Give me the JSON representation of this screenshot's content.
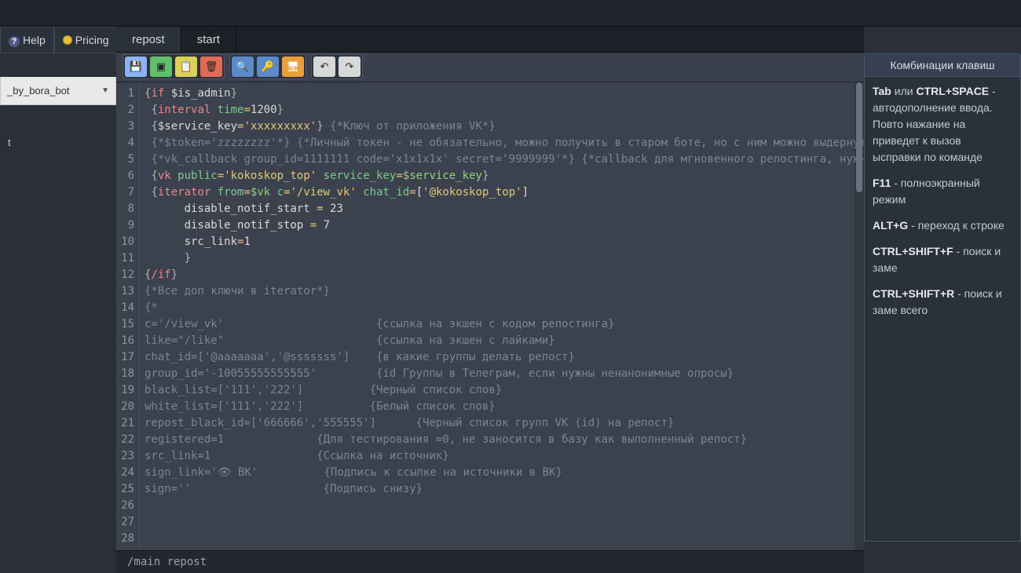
{
  "nav": {
    "help": "Help",
    "pricing": "Pricing"
  },
  "sidebar": {
    "dropdown": "_by_bora_bot",
    "item1": "t"
  },
  "tabs": [
    {
      "label": "repost",
      "active": true
    },
    {
      "label": "start",
      "active": false
    }
  ],
  "toolbar": {
    "save": "save",
    "run": "run",
    "copy": "copy",
    "del": "delete",
    "find": "find",
    "key": "key",
    "screen": "fullscreen",
    "undo": "undo",
    "redo": "redo"
  },
  "editor": {
    "line_count": 28,
    "lines": [
      [
        [
          "br",
          "{"
        ],
        [
          "kw",
          "if"
        ],
        [
          "var",
          " $is_admin"
        ],
        [
          "br",
          "}"
        ]
      ],
      [
        [
          "var",
          " "
        ],
        [
          "br",
          "{"
        ],
        [
          "kw",
          "interval"
        ],
        [
          "var",
          " "
        ],
        [
          "attr",
          "time"
        ],
        [
          "eq",
          "="
        ],
        [
          "num",
          "1200"
        ],
        [
          "br",
          "}"
        ]
      ],
      [
        [
          "var",
          " "
        ],
        [
          "br",
          "{"
        ],
        [
          "var",
          "$service_key"
        ],
        [
          "eq",
          "="
        ],
        [
          "str",
          "'xxxxxxxxx'"
        ],
        [
          "br",
          "}"
        ],
        [
          "var",
          " "
        ],
        [
          "cmt",
          "{*Ключ от приложения VK*}"
        ]
      ],
      [
        [
          "var",
          " "
        ],
        [
          "cmt",
          "{*$token='zzzzzzzz'*} {*Личный токен - не обязательно, можно получить в старом боте, но с ним можно выдернуть исход"
        ]
      ],
      [
        [
          "var",
          " "
        ],
        [
          "cmt",
          "{*vk_callback group_id=1111111 code='x1x1x1x' secret='9999999'*} {*callback для мгновенного репостинга, нужно настр"
        ]
      ],
      [
        [
          "var",
          " "
        ],
        [
          "br",
          "{"
        ],
        [
          "kw",
          "vk"
        ],
        [
          "var",
          " "
        ],
        [
          "attr",
          "public"
        ],
        [
          "eq",
          "="
        ],
        [
          "str",
          "'kokoskop_top'"
        ],
        [
          "var",
          " "
        ],
        [
          "attr",
          "service_key"
        ],
        [
          "eq",
          "="
        ],
        [
          "varb",
          "$service_key"
        ],
        [
          "br",
          "}"
        ]
      ],
      [
        [
          "var",
          " "
        ],
        [
          "br",
          "{"
        ],
        [
          "kw",
          "iterator"
        ],
        [
          "var",
          " "
        ],
        [
          "attr",
          "from"
        ],
        [
          "eq",
          "="
        ],
        [
          "varb",
          "$vk"
        ],
        [
          "var",
          " "
        ],
        [
          "attr",
          "c"
        ],
        [
          "eq",
          "="
        ],
        [
          "str",
          "'/view_vk'"
        ],
        [
          "var",
          " "
        ],
        [
          "attr",
          "chat_id"
        ],
        [
          "eq",
          "="
        ],
        [
          "var",
          "["
        ],
        [
          "str",
          "'@kokoskop_top'"
        ],
        [
          "var",
          "]"
        ]
      ],
      [
        [
          "var",
          "      disable_notif_start "
        ],
        [
          "eq",
          "= "
        ],
        [
          "num",
          "23"
        ]
      ],
      [
        [
          "var",
          "      disable_notif_stop "
        ],
        [
          "eq",
          "= "
        ],
        [
          "num",
          "7"
        ]
      ],
      [
        [
          "var",
          "      src_link"
        ],
        [
          "eq",
          "="
        ],
        [
          "num",
          "1"
        ]
      ],
      [
        [
          "var",
          "      "
        ],
        [
          "br",
          "}"
        ]
      ],
      [
        [
          "br",
          "{"
        ],
        [
          "kw",
          "/if"
        ],
        [
          "br",
          "}"
        ]
      ],
      [
        [
          "var",
          ""
        ]
      ],
      [
        [
          "var",
          ""
        ]
      ],
      [
        [
          "var",
          ""
        ]
      ],
      [
        [
          "cmt",
          "{*Все доп ключи в iterator*}"
        ]
      ],
      [
        [
          "cmt",
          "{*"
        ]
      ],
      [
        [
          "cmt",
          "c='/view_vk'                       {ссылка на экшен с кодом репостинга}"
        ]
      ],
      [
        [
          "cmt",
          "like=\"/like\"                       {ссылка на экшен с лайками}"
        ]
      ],
      [
        [
          "cmt",
          "chat_id=['@aaaaaaa','@sssssss']    {в какие группы делать репост}"
        ]
      ],
      [
        [
          "cmt",
          "group_id='-10055555555555'         {id Группы в Телеграм, если нужны ненанонимные опросы}"
        ]
      ],
      [
        [
          "cmt",
          "black_list=['111','222']          {Черный список слов}"
        ]
      ],
      [
        [
          "cmt",
          "white_list=['111','222']          {Белый список слов}"
        ]
      ],
      [
        [
          "cmt",
          "repost_black_id=['666666','555555']      {Черный список групп VK (id) на репост}"
        ]
      ],
      [
        [
          "cmt",
          "registered=1              {Для тестирования =0, не заносится в базу как выполненный репост}"
        ]
      ],
      [
        [
          "cmt",
          "src_link=1                {Ссылка на источник}"
        ]
      ],
      [
        [
          "cmt",
          "sign_link='👁 ВК'          {Подпись к ссылке на источники в ВК}"
        ]
      ],
      [
        [
          "cmt",
          "sign=''                    {Подпись снизу}"
        ]
      ]
    ]
  },
  "right_panel": {
    "title": "Комбинации клавиш",
    "tips": [
      {
        "bold": "Tab",
        "mid": " или ",
        "bold2": "CTRL+SPACE",
        "rest": " - автодополнение ввода. Повто нажание на приведет к вызов ысправки по команде"
      },
      {
        "bold": "F11",
        "rest": " - полноэкранный режим"
      },
      {
        "bold": "ALT+G",
        "rest": " - переход к строке"
      },
      {
        "bold": "CTRL+SHIFT+F",
        "rest": " - поиск и заме"
      },
      {
        "bold": "CTRL+SHIFT+R",
        "rest": " - поиск и заме всего"
      }
    ]
  },
  "status": {
    "path": "/main  repost"
  }
}
